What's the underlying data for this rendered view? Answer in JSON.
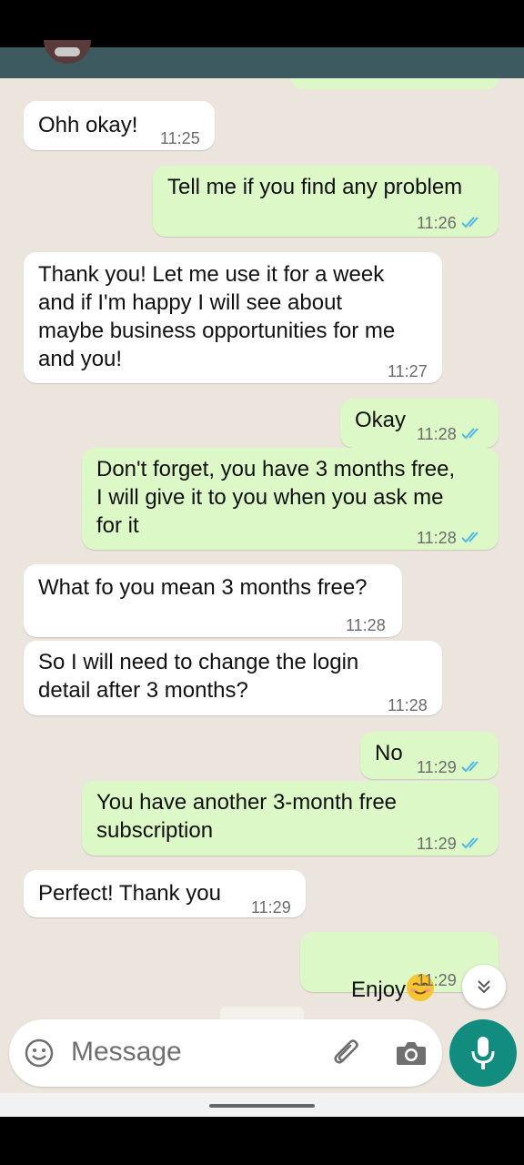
{
  "messages": [
    {
      "lines": "Ohh okay!",
      "time": "11:25",
      "dir": "in"
    },
    {
      "lines": "Tell me if you find any problem",
      "time": "11:26",
      "dir": "out",
      "read": true
    },
    {
      "lines": "Thank you! Let me use it for a week\nand if I'm happy I will see about\nmaybe business opportunities for me\nand you!",
      "time": "11:27",
      "dir": "in"
    },
    {
      "lines": "Okay",
      "time": "11:28",
      "dir": "out",
      "read": true
    },
    {
      "lines": "Don't forget, you have 3 months free,\nI will give it to you when you ask me\nfor it",
      "time": "11:28",
      "dir": "out",
      "read": true
    },
    {
      "lines": "What fo you mean 3 months free?",
      "time": "11:28",
      "dir": "in"
    },
    {
      "lines": "So I will need to change the login\ndetail after 3 months?",
      "time": "11:28",
      "dir": "in"
    },
    {
      "lines": "No",
      "time": "11:29",
      "dir": "out",
      "read": true
    },
    {
      "lines": "You have another 3-month free\nsubscription",
      "time": "11:29",
      "dir": "out",
      "read": true
    },
    {
      "lines": "Perfect! Thank you",
      "time": "11:29",
      "dir": "in"
    },
    {
      "lines": "Enjoy",
      "time": "11:29",
      "dir": "out",
      "emoji": "smiling-face-emoji"
    }
  ],
  "composer": {
    "placeholder": "Message"
  },
  "icons": {
    "emoji": "smiley-icon",
    "attach": "paperclip-icon",
    "camera": "camera-icon",
    "mic": "microphone-icon",
    "scroll": "double-chevron-down-icon",
    "read_receipt": "double-check-icon"
  },
  "colors": {
    "chat_bg": "#ece5dd",
    "incoming": "#ffffff",
    "outgoing": "#dcf8c6",
    "header": "#3c5a5f",
    "accent": "#128c7e",
    "tick": "#4fb6ec"
  }
}
